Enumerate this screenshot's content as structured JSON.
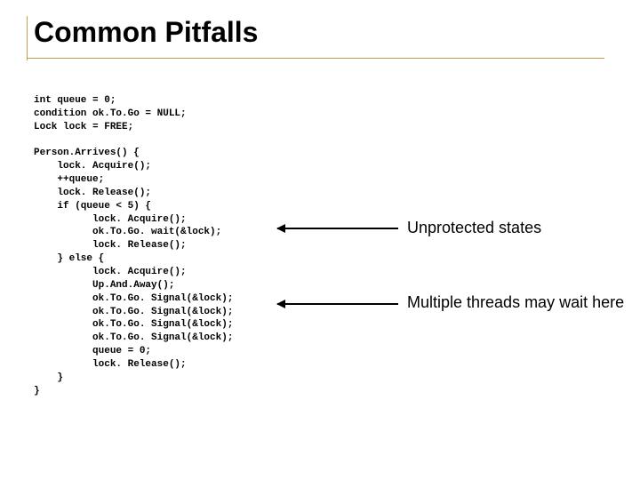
{
  "title": "Common Pitfalls",
  "code": "int queue = 0;\ncondition ok.To.Go = NULL;\nLock lock = FREE;\n\nPerson.Arrives() {\n    lock. Acquire();\n    ++queue;\n    lock. Release();\n    if (queue < 5) {\n          lock. Acquire();\n          ok.To.Go. wait(&lock);\n          lock. Release();\n    } else {\n          lock. Acquire();\n          Up.And.Away();\n          ok.To.Go. Signal(&lock);\n          ok.To.Go. Signal(&lock);\n          ok.To.Go. Signal(&lock);\n          ok.To.Go. Signal(&lock);\n          queue = 0;\n          lock. Release();\n    }\n}",
  "annotations": {
    "unprotected": "Unprotected states",
    "multiple": "Multiple threads may wait here"
  }
}
